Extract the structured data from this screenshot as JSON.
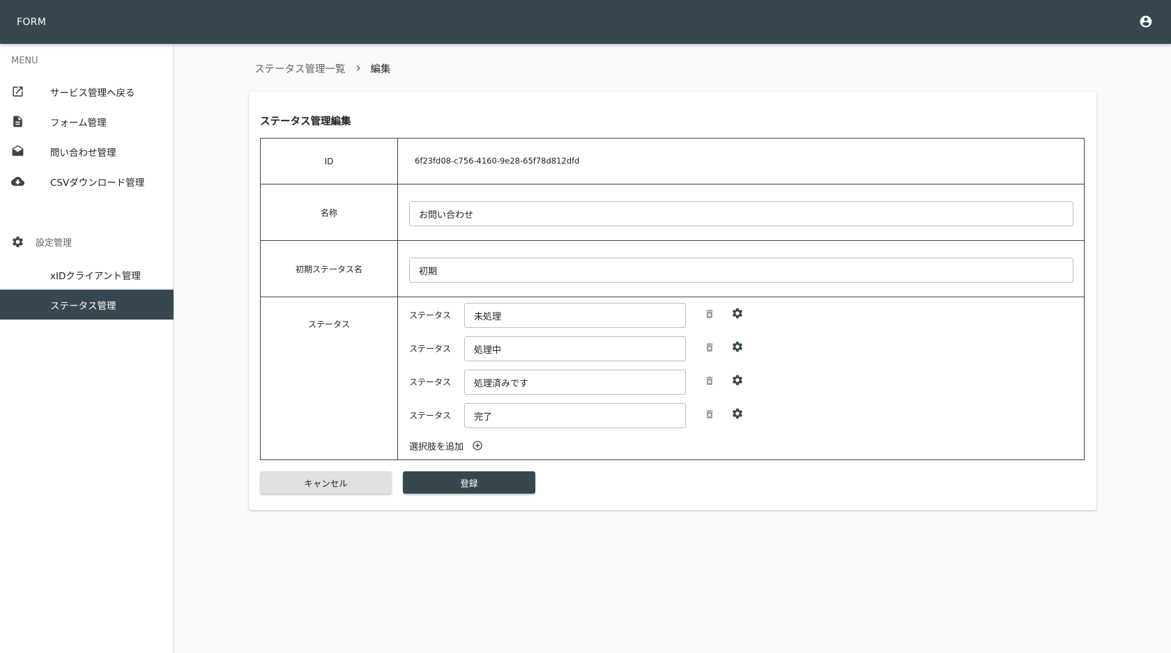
{
  "app": {
    "title": "FORM"
  },
  "icons": {
    "account": "account-circle-icon",
    "open_in_new": "open-in-new-icon",
    "document": "description-icon",
    "mail": "drafts-icon",
    "cloud_download": "cloud-download-icon",
    "settings": "gear-icon",
    "trash": "trash-icon",
    "add": "add-circle-outline-icon",
    "chevron": "chevron-right-icon"
  },
  "colors": {
    "appbar": "#37474f",
    "active_nav": "#37474f",
    "primary_button": "#37474f",
    "cancel_button": "#e0e0e0"
  },
  "sidebar": {
    "menu_label": "MENU",
    "items": [
      {
        "label": "サービス管理へ戻る"
      },
      {
        "label": "フォーム管理"
      },
      {
        "label": "問い合わせ管理"
      },
      {
        "label": "CSVダウンロード管理"
      }
    ],
    "settings_section": {
      "label": "設定管理"
    },
    "sub_items": [
      {
        "label": "xIDクライアント管理"
      },
      {
        "label": "ステータス管理"
      }
    ]
  },
  "breadcrumb": {
    "parent": "ステータス管理一覧",
    "current": "編集"
  },
  "card": {
    "title": "ステータス管理編集",
    "fields": {
      "id": {
        "label": "ID",
        "value": "6f23fd08-c756-4160-9e28-65f78d812dfd"
      },
      "name": {
        "label": "名称",
        "value": "お問い合わせ"
      },
      "initial_status": {
        "label": "初期ステータス名",
        "value": "初期"
      },
      "statuses": {
        "label": "ステータス",
        "items": [
          {
            "label": "ステータス",
            "value": "未処理"
          },
          {
            "label": "ステータス",
            "value": "処理中"
          },
          {
            "label": "ステータス",
            "value": "処理済みです"
          },
          {
            "label": "ステータス",
            "value": "完了"
          }
        ],
        "add_option_label": "選択肢を追加"
      }
    },
    "buttons": {
      "cancel": "キャンセル",
      "submit": "登録"
    }
  }
}
